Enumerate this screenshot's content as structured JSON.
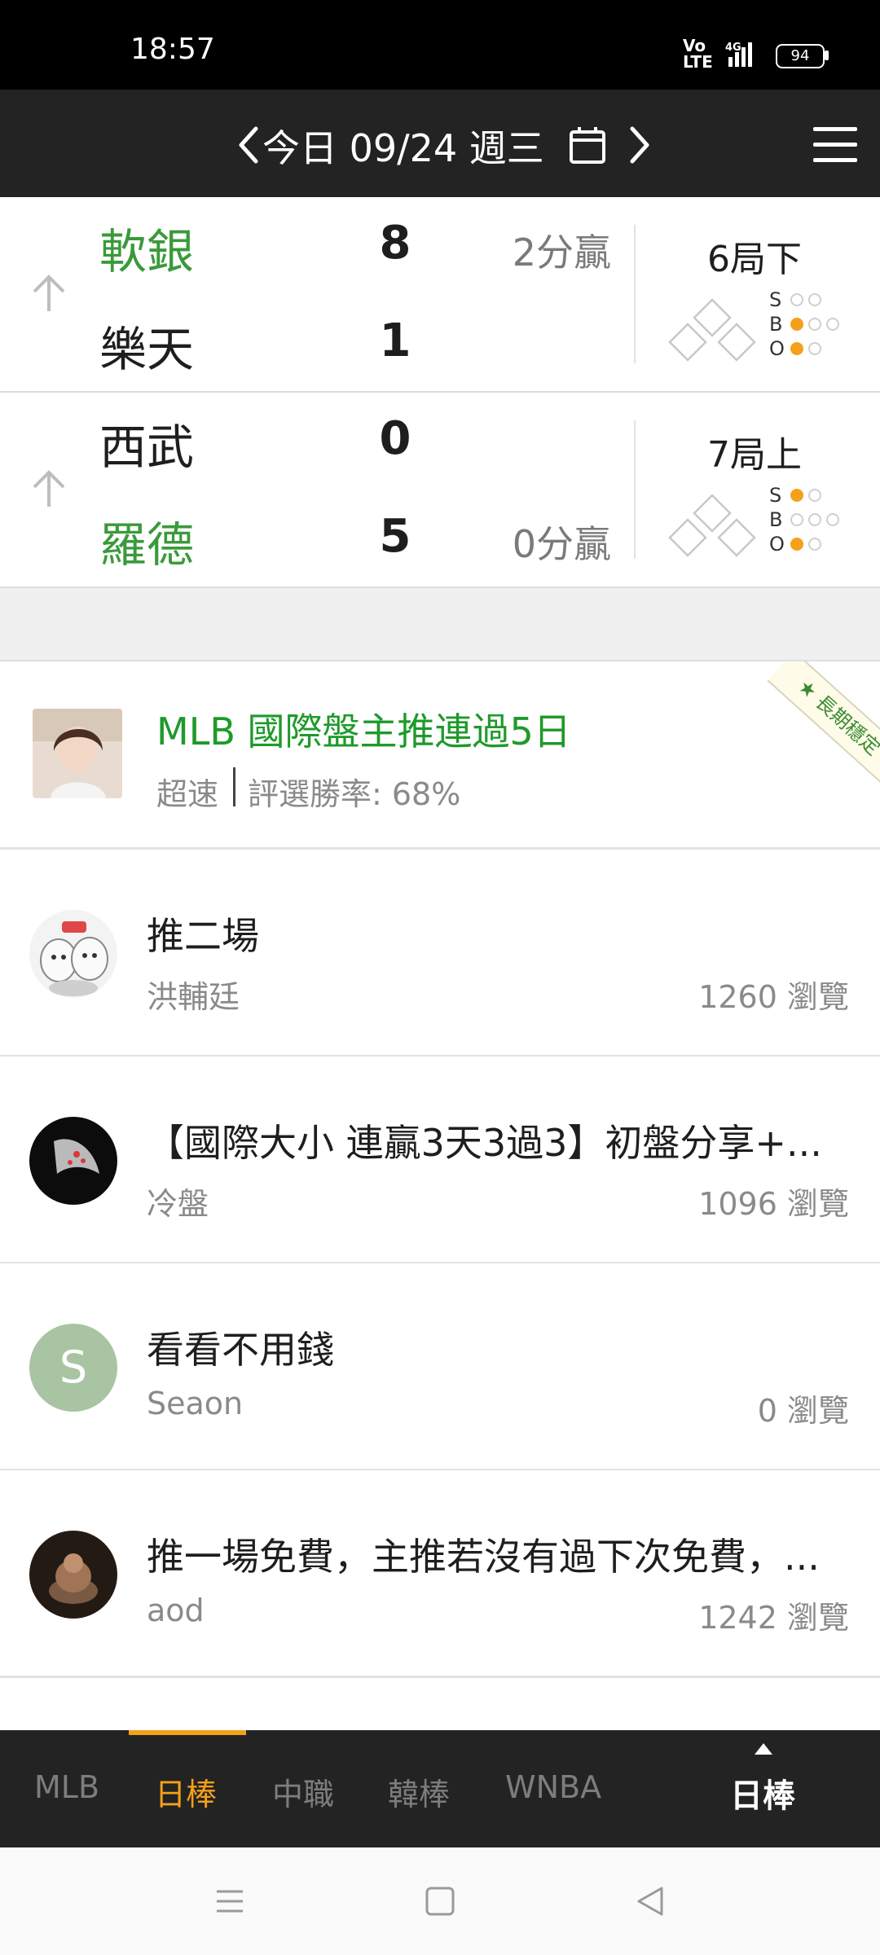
{
  "status_bar": {
    "time": "18:57",
    "network": "4G",
    "volte": "Vo LTE",
    "battery": "94"
  },
  "header": {
    "prev": "<",
    "date_label": "今日 09/24 週三",
    "next": ">"
  },
  "games": [
    {
      "teams": [
        {
          "name": "軟銀",
          "score": "8",
          "color": "#3a9a3a",
          "win_label": "2分贏"
        },
        {
          "name": "樂天",
          "score": "1",
          "color": "#1e1e1e",
          "win_label": ""
        }
      ],
      "inning": "6局下",
      "count": {
        "strikes": 0,
        "balls": 1,
        "outs": 1
      }
    },
    {
      "teams": [
        {
          "name": "西武",
          "score": "0",
          "color": "#1e1e1e",
          "win_label": ""
        },
        {
          "name": "羅德",
          "score": "5",
          "color": "#3a9a3a",
          "win_label": "0分贏"
        }
      ],
      "inning": "7局上",
      "count": {
        "strikes": 1,
        "balls": 0,
        "outs": 1
      }
    }
  ],
  "sbo_labels": {
    "s": "S",
    "b": "B",
    "o": "O"
  },
  "featured": {
    "title": "MLB 國際盤主推連過5日",
    "speed": "超速",
    "rate": "評選勝率: 68%",
    "ribbon": "長期穩定"
  },
  "posts": [
    {
      "title": "推二場",
      "author": "洪輔廷",
      "views": "1260 瀏覽",
      "avatar": "cartoon-avatar"
    },
    {
      "title": "【國際大小 連贏3天3過3】初盤分享+...",
      "author": "冷盤",
      "views": "1096 瀏覽",
      "avatar": "dark-photo-avatar"
    },
    {
      "title": "看看不用錢",
      "author": "Seaon",
      "views": "0 瀏覽",
      "avatar": "letter-avatar",
      "avatar_letter": "S",
      "avatar_color": "#a9c4a2"
    },
    {
      "title": "推一場免費，主推若沒有過下次免費，...",
      "author": "aod",
      "views": "1242 瀏覽",
      "avatar": "dark-photo-avatar"
    }
  ],
  "tabs": [
    "MLB",
    "日棒",
    "中職",
    "韓棒",
    "WNBA"
  ],
  "active_tab": "日棒",
  "current_league": "日棒",
  "colors": {
    "accent": "#f5a01a",
    "green": "#3a9a3a",
    "header_bg": "#232323"
  }
}
